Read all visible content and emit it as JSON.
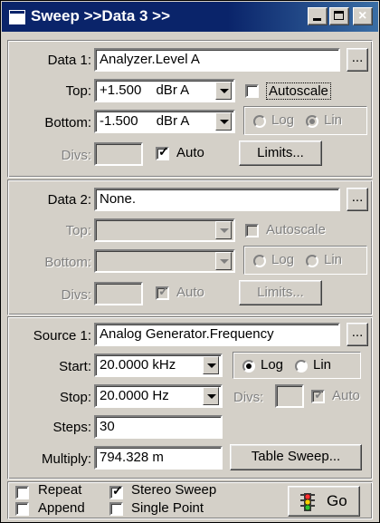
{
  "window": {
    "title": "Sweep >>Data 3 >>"
  },
  "data1": {
    "label": "Data 1:",
    "value": "Analyzer.Level A",
    "top_label": "Top:",
    "top_value": "+1.500",
    "top_unit": "dBr A",
    "bottom_label": "Bottom:",
    "bottom_value": "-1.500",
    "bottom_unit": "dBr A",
    "divs_label": "Divs:",
    "divs_value": "",
    "auto_label": "Auto",
    "autoscale_label": "Autoscale",
    "log_label": "Log",
    "lin_label": "Lin",
    "limits_label": "Limits...",
    "browse_label": "..."
  },
  "data2": {
    "label": "Data 2:",
    "value": "None.",
    "top_label": "Top:",
    "bottom_label": "Bottom:",
    "divs_label": "Divs:",
    "auto_label": "Auto",
    "autoscale_label": "Autoscale",
    "log_label": "Log",
    "lin_label": "Lin",
    "limits_label": "Limits...",
    "browse_label": "..."
  },
  "source1": {
    "label": "Source 1:",
    "value": "Analog Generator.Frequency",
    "browse_label": "...",
    "start_label": "Start:",
    "start_value": "20.0000 kHz",
    "stop_label": "Stop:",
    "stop_value": "20.0000  Hz",
    "divs_label": "Divs:",
    "auto_label": "Auto",
    "log_label": "Log",
    "lin_label": "Lin",
    "steps_label": "Steps:",
    "steps_value": "30",
    "multiply_label": "Multiply:",
    "multiply_value": "794.328 m",
    "table_sweep_label": "Table Sweep..."
  },
  "bottom": {
    "repeat_label": "Repeat",
    "stereo_label": "Stereo Sweep",
    "append_label": "Append",
    "single_point_label": "Single Point",
    "go_label": "Go"
  }
}
